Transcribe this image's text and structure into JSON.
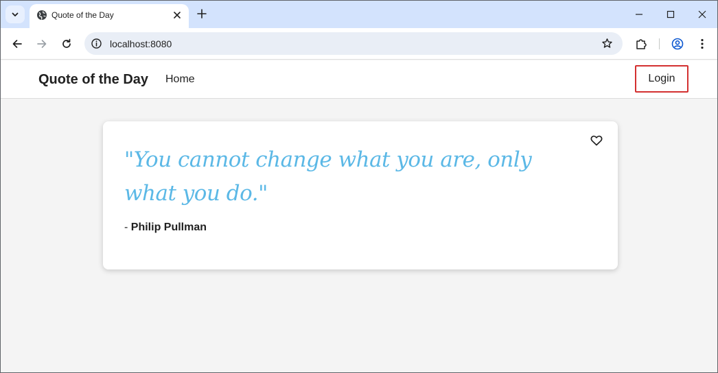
{
  "browser": {
    "tab_title": "Quote of the Day",
    "url": "localhost:8080"
  },
  "page": {
    "brand": "Quote of the Day",
    "nav": {
      "home": "Home"
    },
    "login_label": "Login",
    "quote": {
      "text": "\"You cannot change what you are, only what you do.\"",
      "author_prefix": "- ",
      "author": "Philip Pullman"
    }
  },
  "colors": {
    "quote_text": "#5bb8e6",
    "login_border": "#d32f2f",
    "tabstrip": "#d3e3fd"
  },
  "icons": {
    "tab_search": "chevron-down-icon",
    "favicon": "globe-icon",
    "tab_close": "close-icon",
    "new_tab": "plus-icon",
    "back": "arrow-left-icon",
    "forward": "arrow-right-icon",
    "reload": "reload-icon",
    "site_info": "info-icon",
    "bookmark": "star-icon",
    "extensions": "puzzle-icon",
    "profile": "profile-icon",
    "menu": "more-vert-icon",
    "favorite": "heart-icon"
  }
}
